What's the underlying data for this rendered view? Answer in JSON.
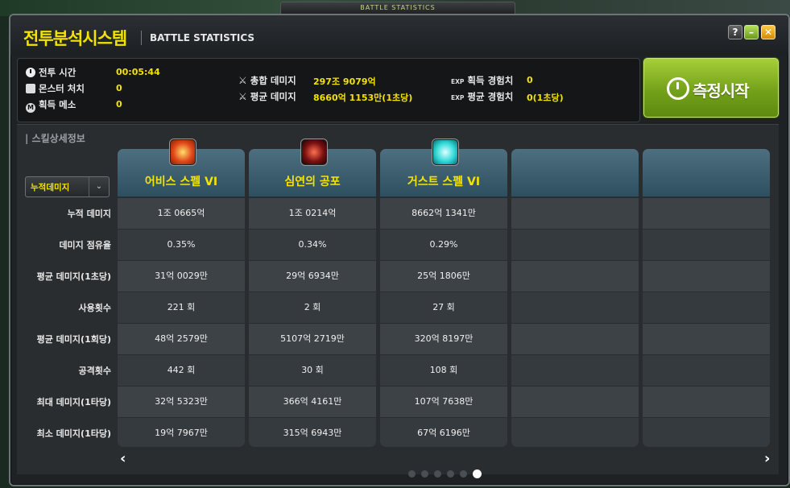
{
  "window": {
    "top_tab": "BATTLE STATISTICS",
    "title_ko": "전투분석시스템",
    "title_en": "BATTLE STATISTICS",
    "help_label": "?",
    "min_label": "–",
    "close_label": "✕"
  },
  "stats": {
    "battle_time_label": "전투 시간",
    "battle_time": "00:05:44",
    "monster_kills_label": "몬스터 처치",
    "monster_kills": "0",
    "meso_label": "획득 메소",
    "meso": "0",
    "total_damage_label": "총합 데미지",
    "total_damage": "297조 9079억",
    "avg_damage_label": "평균 데미지",
    "avg_damage": "8660억 1153만(1초당)",
    "exp_gained_label": "획득 경험치",
    "exp_gained": "0",
    "avg_exp_label": "평균 경험치",
    "avg_exp": "0(1초당)",
    "exp_tag": "EXP"
  },
  "start_button": {
    "label": "측정시작"
  },
  "skills_section": {
    "label": "| 스킬상세정보",
    "dropdown_value": "누적데미지",
    "dropdown_arrow": "⌄",
    "row_labels": [
      "누적 데미지",
      "데미지 점유율",
      "평균 데미지(1초당)",
      "사용횟수",
      "평균 데미지(1회당)",
      "공격횟수",
      "최대 데미지(1타당)",
      "최소 데미지(1타당)"
    ],
    "columns": [
      {
        "name": "어비스 스펠 VI",
        "icon": "abyss-spell-icon",
        "values": [
          "1조 0665억",
          "0.35%",
          "31억 0029만",
          "221 회",
          "48억 2579만",
          "442 회",
          "32억 5323만",
          "19억 7967만"
        ]
      },
      {
        "name": "심연의 공포",
        "icon": "abyss-fear-icon",
        "values": [
          "1조 0214억",
          "0.34%",
          "29억 6934만",
          "2 회",
          "5107억 2719만",
          "30 회",
          "366억 4161만",
          "315억 6943만"
        ]
      },
      {
        "name": "거스트 스펠 VI",
        "icon": "gust-spell-icon",
        "values": [
          "8662억 1341만",
          "0.29%",
          "25억 1806만",
          "27 회",
          "320억 8197만",
          "108 회",
          "107억 7638만",
          "67억 6196만"
        ]
      },
      {
        "name": "",
        "icon": "",
        "values": [
          "",
          "",
          "",
          "",
          "",
          "",
          "",
          ""
        ]
      },
      {
        "name": "",
        "icon": "",
        "values": [
          "",
          "",
          "",
          "",
          "",
          "",
          "",
          ""
        ]
      }
    ],
    "prev_label": "‹",
    "next_label": "›",
    "page_count": 6,
    "active_page": 6
  }
}
